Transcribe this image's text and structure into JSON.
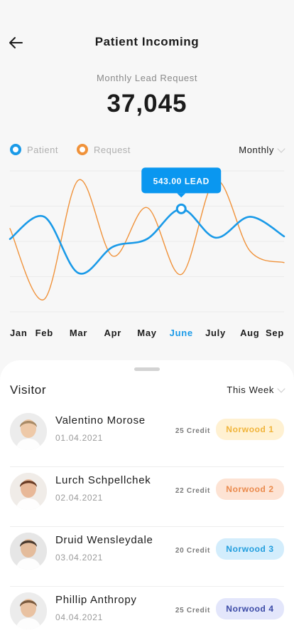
{
  "header": {
    "title": "Patient Incoming",
    "back_icon": "arrow-left-icon"
  },
  "summary": {
    "label": "Monthly Lead Request",
    "value": "37,045"
  },
  "legend": {
    "patient": "Patient",
    "request": "Request"
  },
  "period_select": {
    "value": "Monthly"
  },
  "colors": {
    "patient": "#1a9ae8",
    "request": "#f0923a",
    "active_month": "#1a9ae8",
    "tooltip_bg": "#0a97f0"
  },
  "chart_data": {
    "type": "line",
    "categories": [
      "Jan",
      "Feb",
      "Mar",
      "Apr",
      "May",
      "June",
      "July",
      "Aug",
      "Sep"
    ],
    "active_category": "June",
    "tooltip": {
      "text": "543.00 LEAD",
      "series": "Patient",
      "category": "June"
    },
    "grid": true,
    "series": [
      {
        "name": "Patient",
        "values": [
          48,
          65,
          22,
          42,
          48,
          71,
          49,
          65,
          50
        ]
      },
      {
        "name": "Request",
        "values": [
          56,
          2,
          93,
          35,
          72,
          21,
          93,
          39,
          30
        ]
      }
    ]
  },
  "visitors": {
    "title": "Visitor",
    "filter": "This Week",
    "rows": [
      {
        "name": "Valentino Morose",
        "date": "01.04.2021",
        "credit": "25 Credit",
        "badge": "Norwood 1",
        "badge_bg": "#fff1d2",
        "badge_fg": "#f1b43a",
        "avatar_hair": "#a88a66",
        "avatar_skin": "#eec9a8",
        "avatar_bg": "#ececec"
      },
      {
        "name": "Lurch Schpellchek",
        "date": "02.04.2021",
        "credit": "22 Credit",
        "badge": "Norwood 2",
        "badge_bg": "#fde3d4",
        "badge_fg": "#ea8a4c",
        "avatar_hair": "#6a3d26",
        "avatar_skin": "#e8b898",
        "avatar_bg": "#f0ece8"
      },
      {
        "name": "Druid Wensleydale",
        "date": "03.04.2021",
        "credit": "20 Credit",
        "badge": "Norwood 3",
        "badge_bg": "#d3edfc",
        "badge_fg": "#229ede",
        "avatar_hair": "#4a3a2e",
        "avatar_skin": "#e4bc9c",
        "avatar_bg": "#e6e6e6"
      },
      {
        "name": "Phillip Anthropy",
        "date": "04.04.2021",
        "credit": "25 Credit",
        "badge": "Norwood 4",
        "badge_bg": "#e3e6fb",
        "badge_fg": "#3b4aa6",
        "avatar_hair": "#7a5a3e",
        "avatar_skin": "#e9c2a2",
        "avatar_bg": "#ececec"
      }
    ]
  }
}
